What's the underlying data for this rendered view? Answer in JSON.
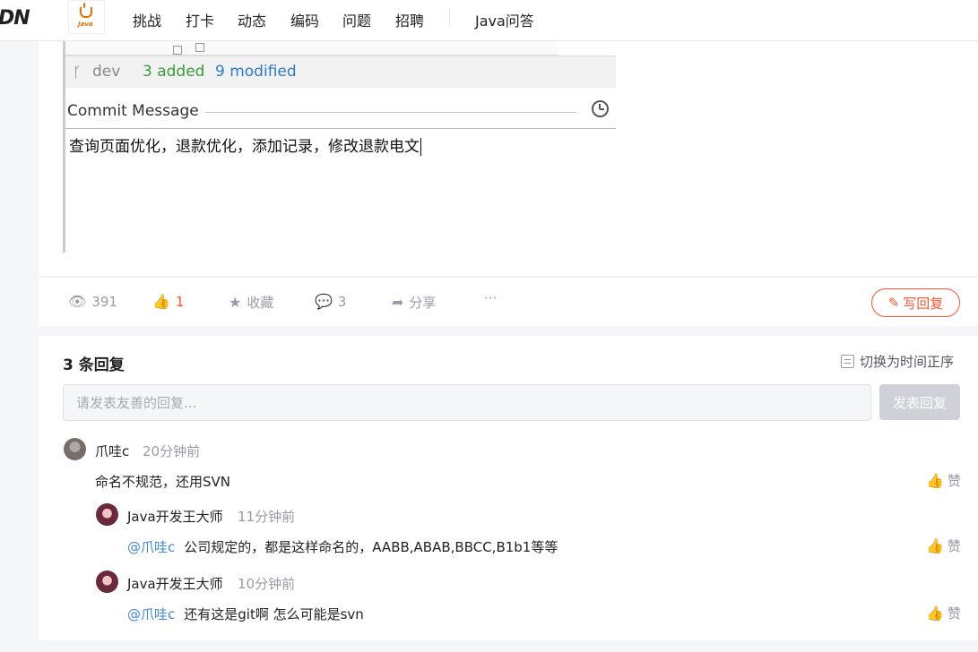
{
  "nav": {
    "brand": "DN",
    "logo_text": "Java",
    "items": [
      "挑战",
      "打卡",
      "动态",
      "编码",
      "问题",
      "招聘"
    ],
    "community": "Java问答"
  },
  "screenshot": {
    "branch": "dev",
    "added": "3 added",
    "modified": "9 modified",
    "commit_label": "Commit Message",
    "commit_text": "查询页面优化，退款优化，添加记录，修改退款电文"
  },
  "actions": {
    "views": "391",
    "likes": "1",
    "collect": "收藏",
    "comments": "3",
    "share": "分享",
    "more": "···",
    "write_reply": "写回复"
  },
  "comments": {
    "title": "3 条回复",
    "sort_label": "切换为时间正序",
    "input_placeholder": "请发表友善的回复...",
    "submit_label": "发表回复",
    "like_label": "赞",
    "items": [
      {
        "user": "爪哇c",
        "time": "20分钟前",
        "text": "命名不规范，还用SVN",
        "mention": ""
      },
      {
        "user": "Java开发王大师",
        "time": "11分钟前",
        "mention": "@爪哇c",
        "text": "公司规定的，都是这样命名的，AABB,ABAB,BBCC,B1b1等等"
      },
      {
        "user": "Java开发王大师",
        "time": "10分钟前",
        "mention": "@爪哇c",
        "text": "还有这是git啊 怎么可能是svn"
      }
    ]
  },
  "colors": {
    "accent": "#fc5531",
    "mention": "#3f88d6",
    "added": "#3a9b3a",
    "modified": "#2d7ac7"
  }
}
